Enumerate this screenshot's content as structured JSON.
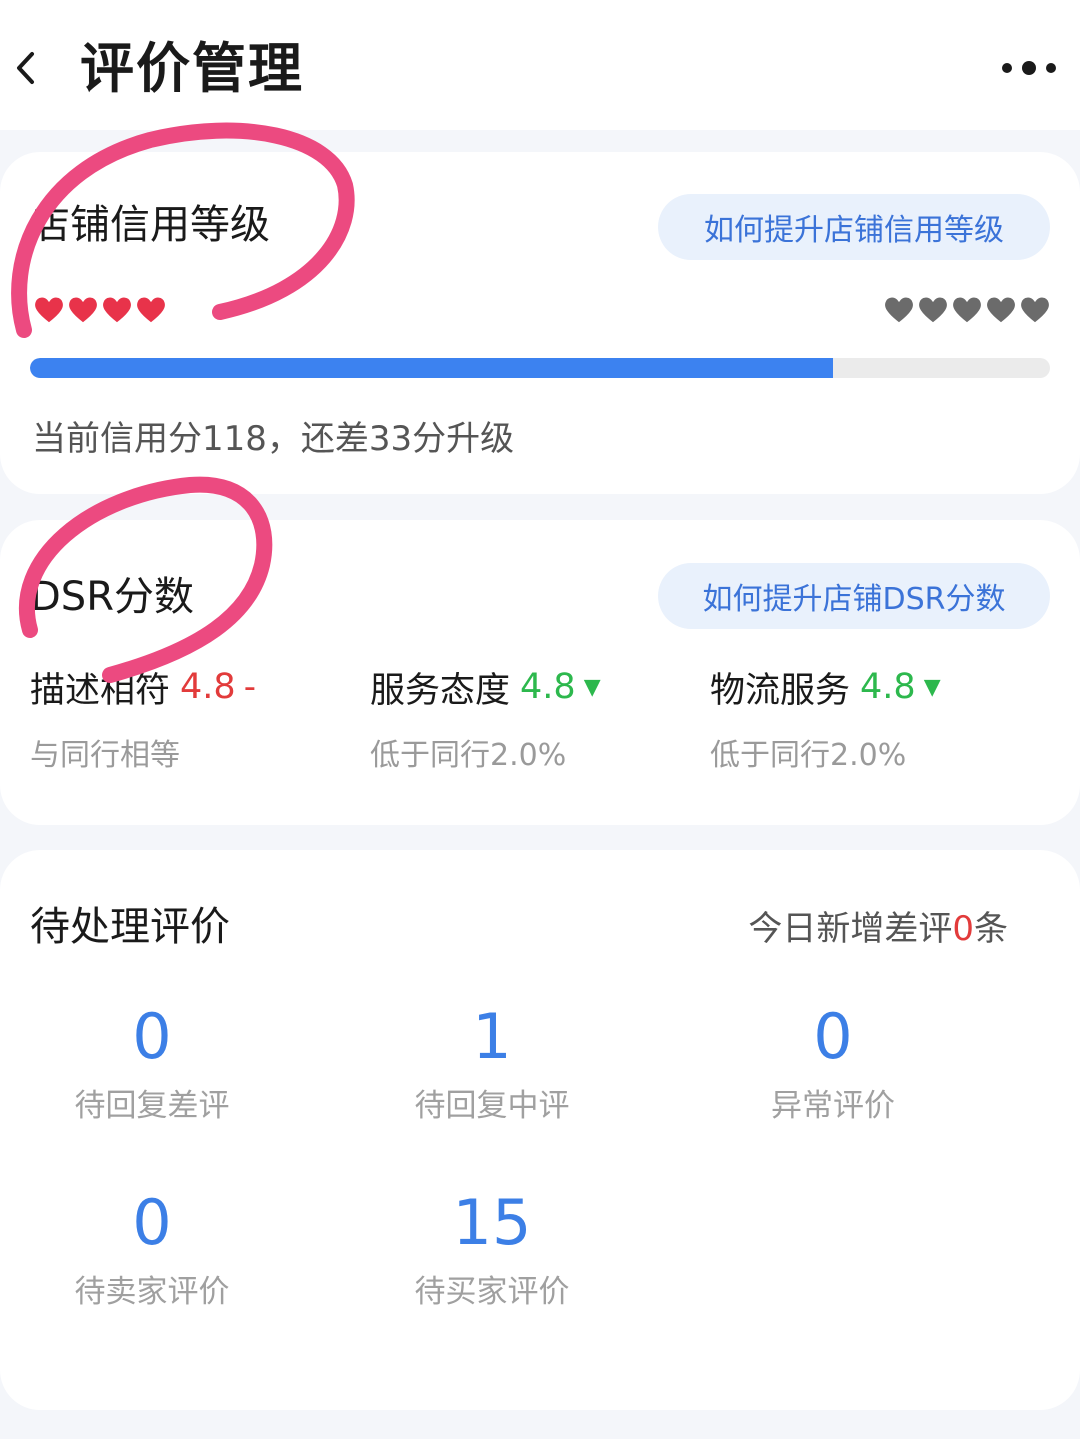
{
  "header": {
    "title": "评价管理"
  },
  "credit": {
    "title": "店铺信用等级",
    "help_button": "如何提升店铺信用等级",
    "progress_fraction": 0.787,
    "summary": "当前信用分118，还差33分升级",
    "left_hearts": 4,
    "right_hearts": 5,
    "colors": {
      "active_heart": "#e8334a",
      "inactive_heart": "#6b6b6b",
      "progress": "#3c82f0"
    }
  },
  "dsr": {
    "title": "DSR分数",
    "help_button": "如何提升店铺DSR分数",
    "items": [
      {
        "label": "描述相符",
        "score": "4.8",
        "trend": "-",
        "compare": "与同行相等",
        "color": "#e23b3b"
      },
      {
        "label": "服务态度",
        "score": "4.8",
        "trend": "▼",
        "compare": "低于同行2.0%",
        "color": "#2db84d"
      },
      {
        "label": "物流服务",
        "score": "4.8",
        "trend": "▼",
        "compare": "低于同行2.0%",
        "color": "#2db84d"
      }
    ]
  },
  "pending": {
    "title": "待处理评价",
    "today_prefix": "今日新增差评",
    "today_count": "0",
    "today_suffix": "条",
    "stats": [
      {
        "value": "0",
        "label": "待回复差评"
      },
      {
        "value": "1",
        "label": "待回复中评"
      },
      {
        "value": "0",
        "label": "异常评价"
      },
      {
        "value": "0",
        "label": "待卖家评价"
      },
      {
        "value": "15",
        "label": "待买家评价"
      }
    ]
  }
}
